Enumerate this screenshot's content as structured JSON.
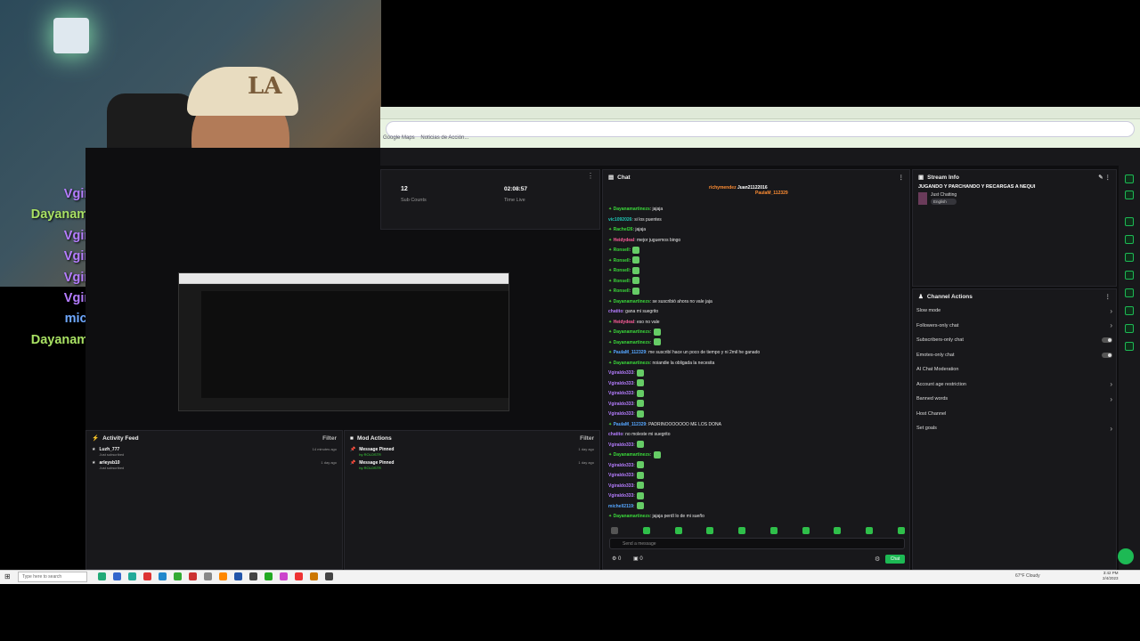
{
  "webcam": {
    "cap_logo": "LA",
    "chat": [
      {
        "name": "chatito",
        "msg": "no moleste mi suegrito",
        "color": "#c084fc",
        "emote": false
      },
      {
        "name": "Vgiraldo333",
        "msg": "",
        "color": "#b57dff",
        "emote": true
      },
      {
        "name": "Dayanamartinezs",
        "msg": "",
        "color": "#a8e063",
        "emote": true
      },
      {
        "name": "Vgiraldo333",
        "msg": "",
        "color": "#b57dff",
        "emote": true
      },
      {
        "name": "Vgiraldo333",
        "msg": "",
        "color": "#b57dff",
        "emote": true
      },
      {
        "name": "Vgiraldo333",
        "msg": "",
        "color": "#b57dff",
        "emote": true
      },
      {
        "name": "Vgiraldo333",
        "msg": "",
        "color": "#b57dff",
        "emote": true
      },
      {
        "name": "michell2119",
        "msg": "",
        "color": "#6ea8ff",
        "emote": true
      },
      {
        "name": "Dayanamartinezs",
        "msg": "jajaja perdí lo de mi sueño",
        "color": "#a8e063",
        "emote": false
      }
    ]
  },
  "stats": {
    "sub_count": "12",
    "sub_label": "Sub Counts",
    "time": "02:08:57",
    "time_label": "Time Live"
  },
  "chat": {
    "title": "Chat",
    "pinned_user1": "richymendez",
    "pinned_user2": "Juan21122016",
    "pinned_user3": "PaulaM_112329",
    "lines": [
      {
        "user": "Dayanamartinezs",
        "text": "jajaja",
        "cls": "c-green",
        "badge": true
      },
      {
        "user": "vic1092026",
        "text": "si los puentes",
        "cls": "c-teal",
        "badge": false
      },
      {
        "user": "Rachel26",
        "text": "jajaja",
        "cls": "c-green",
        "badge": true
      },
      {
        "user": "Heidydeal",
        "text": "mejor juguemos bingo",
        "cls": "c-pink",
        "badge": true
      },
      {
        "user": "Ronsell",
        "text": "",
        "cls": "c-green",
        "badge": true,
        "emote": true
      },
      {
        "user": "Ronsell",
        "text": "",
        "cls": "c-green",
        "badge": true,
        "emote": true
      },
      {
        "user": "Ronsell",
        "text": "",
        "cls": "c-green",
        "badge": true,
        "emote": true
      },
      {
        "user": "Ronsell",
        "text": "",
        "cls": "c-green",
        "badge": true,
        "emote": true
      },
      {
        "user": "Ronsell",
        "text": "",
        "cls": "c-green",
        "badge": true,
        "emote": true
      },
      {
        "user": "Dayanamartinezs",
        "text": "se suscribió ahora no vale jaja",
        "cls": "c-green",
        "badge": true
      },
      {
        "user": "chatito",
        "text": "gana mi suegrito",
        "cls": "c-purple",
        "badge": false
      },
      {
        "user": "Heidydeal",
        "text": "eso no vale",
        "cls": "c-pink",
        "badge": true
      },
      {
        "user": "Dayanamartinezs",
        "text": "",
        "cls": "c-green",
        "badge": true,
        "emote": true
      },
      {
        "user": "Dayanamartinezs",
        "text": "",
        "cls": "c-green",
        "badge": true,
        "emote": true
      },
      {
        "user": "PaulaM_112329",
        "text": "me suscribí hace un poco de tiempo y ni 2mil he ganado",
        "cls": "c-blue",
        "badge": true
      },
      {
        "user": "Dayanamartinezs",
        "text": "noiandie la obligada la necesita",
        "cls": "c-green",
        "badge": true
      },
      {
        "user": "Vgiraldo333",
        "text": "",
        "cls": "c-purple",
        "badge": false,
        "emote": true
      },
      {
        "user": "Vgiraldo333",
        "text": "",
        "cls": "c-purple",
        "badge": false,
        "emote": true
      },
      {
        "user": "Vgiraldo333",
        "text": "",
        "cls": "c-purple",
        "badge": false,
        "emote": true
      },
      {
        "user": "Vgiraldo333",
        "text": "",
        "cls": "c-purple",
        "badge": false,
        "emote": true
      },
      {
        "user": "Vgiraldo333",
        "text": "",
        "cls": "c-purple",
        "badge": false,
        "emote": true
      },
      {
        "user": "PaulaM_112329",
        "text": "PADRINOOOOOOO ME LOS DONA",
        "cls": "c-blue",
        "badge": true
      },
      {
        "user": "chatito",
        "text": "no moleste mi suegrito",
        "cls": "c-purple",
        "badge": false
      },
      {
        "user": "Vgiraldo333",
        "text": "",
        "cls": "c-purple",
        "badge": false,
        "emote": true
      },
      {
        "user": "Dayanamartinezs",
        "text": "",
        "cls": "c-green",
        "badge": true,
        "emote": true
      },
      {
        "user": "Vgiraldo333",
        "text": "",
        "cls": "c-purple",
        "badge": false,
        "emote": true
      },
      {
        "user": "Vgiraldo333",
        "text": "",
        "cls": "c-purple",
        "badge": false,
        "emote": true
      },
      {
        "user": "Vgiraldo333",
        "text": "",
        "cls": "c-purple",
        "badge": false,
        "emote": true
      },
      {
        "user": "Vgiraldo333",
        "text": "",
        "cls": "c-purple",
        "badge": false,
        "emote": true
      },
      {
        "user": "michell2119",
        "text": "",
        "cls": "c-blue",
        "badge": false,
        "emote": true
      },
      {
        "user": "Dayanamartinezs",
        "text": "jajaja perdí lo de mi sueño",
        "cls": "c-green",
        "badge": true
      }
    ],
    "input_placeholder": "Send a message",
    "send_label": "Chat",
    "points_value": "0",
    "viewers_value": "0"
  },
  "stream_info": {
    "header": "Stream Info",
    "title": "JUGANDO Y PARCHANDO Y RECARGAS A NEQUI",
    "category": "Just Chatting",
    "language": "English"
  },
  "channel_actions": {
    "header": "Channel Actions",
    "items": [
      {
        "label": "Slow mode",
        "kind": "chevron"
      },
      {
        "label": "Followers-only chat",
        "kind": "chevron"
      },
      {
        "label": "Subscribers-only chat",
        "kind": "toggle"
      },
      {
        "label": "Emotes-only chat",
        "kind": "toggle"
      },
      {
        "label": "AI Chat Moderation",
        "kind": "none"
      },
      {
        "label": "Account age restriction",
        "kind": "chevron"
      },
      {
        "label": "Banned words",
        "kind": "chevron"
      },
      {
        "label": "Host Channel",
        "kind": "none"
      },
      {
        "label": "Set goals",
        "kind": "chevron"
      }
    ]
  },
  "activity": {
    "header": "Activity Feed",
    "filter": "Filter",
    "items": [
      {
        "user": "Luzh_777",
        "sub": "Just subscribed",
        "time": "14 minutes ago"
      },
      {
        "user": "arleysb10",
        "sub": "Just subscribed",
        "time": "1 day ago"
      }
    ]
  },
  "mod": {
    "header": "Mod Actions",
    "filter": "Filter",
    "items": [
      {
        "title": "Message Pinned",
        "by": "by ROLOSTR",
        "time": "1 day ago"
      },
      {
        "title": "Message Pinned",
        "by": "by ROLOSTR",
        "time": "1 day ago"
      }
    ]
  },
  "taskbar": {
    "search": "Type here to search",
    "weather": "67°F Cloudy",
    "time": "3:42 PM",
    "date": "2/4/2023"
  },
  "bookmarks": [
    "Google Maps",
    "Noticias de Acción..."
  ]
}
